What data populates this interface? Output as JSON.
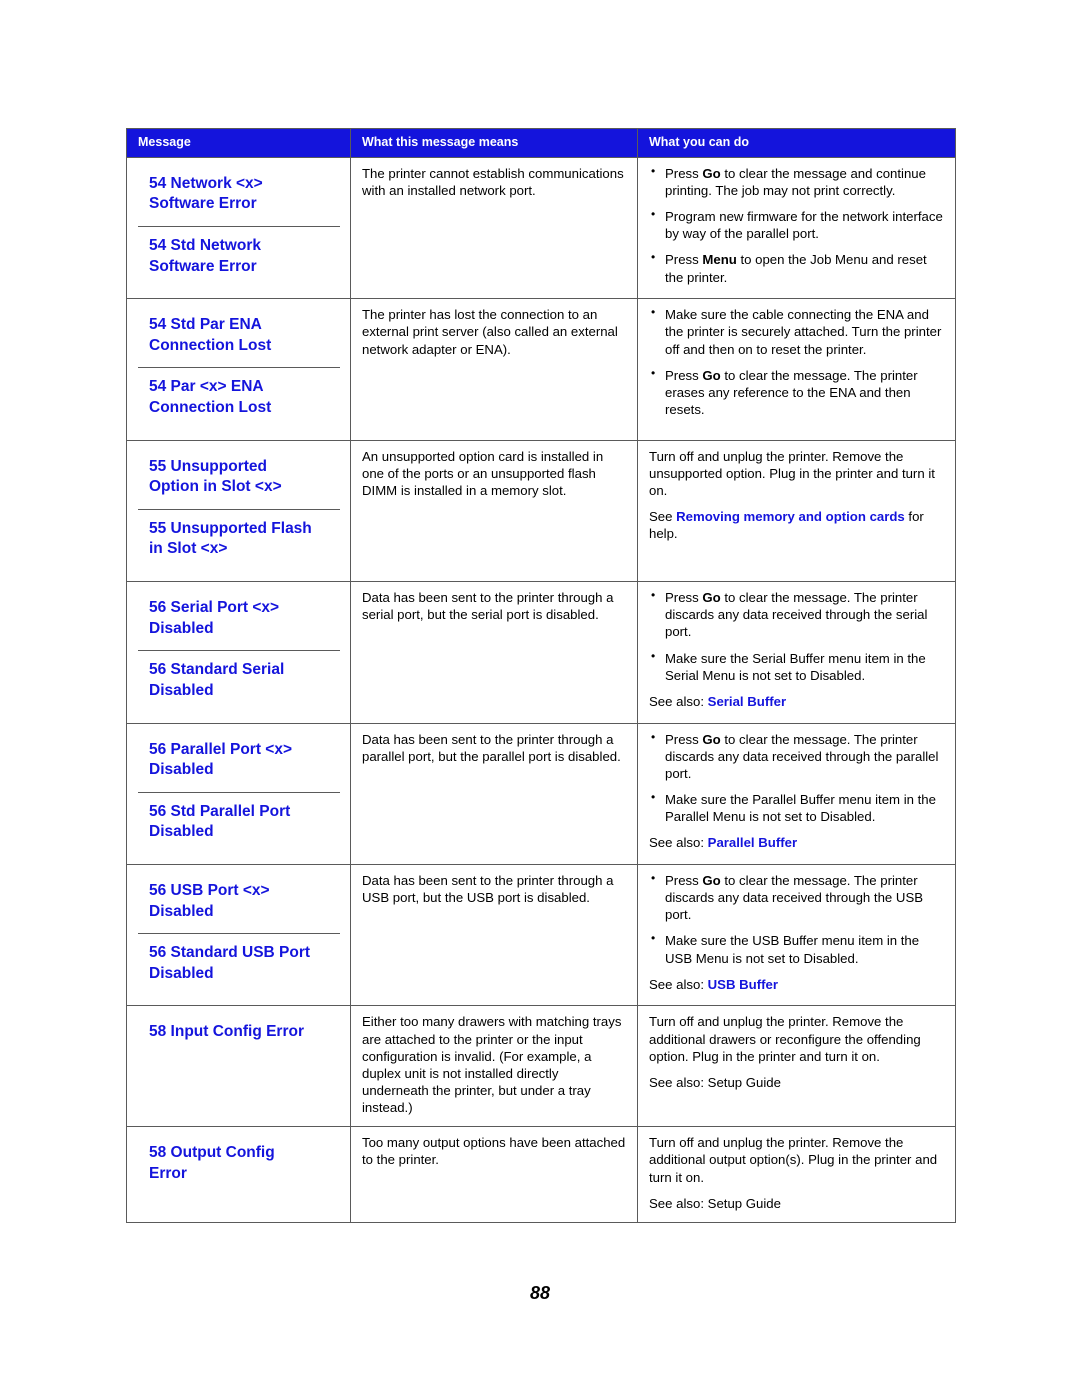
{
  "page": {
    "number": "88"
  },
  "table": {
    "headers": {
      "message": "Message",
      "means": "What this message means",
      "action": "What you can do"
    },
    "rows": [
      {
        "messages": [
          "54 Network <x>\nSoftware Error",
          "54 Std Network\nSoftware Error"
        ],
        "means": "The printer cannot establish communications with an installed network port.",
        "bullets": [
          {
            "pre": "Press ",
            "bold": "Go",
            "post": " to clear the message and continue printing. The job may not print correctly."
          },
          {
            "pre": "Program new firmware for the network interface by way of the parallel port.",
            "bold": "",
            "post": ""
          },
          {
            "pre": "Press ",
            "bold": "Menu",
            "post": " to open the Job Menu and reset the printer."
          }
        ],
        "notes": []
      },
      {
        "messages": [
          "54 Std Par ENA\nConnection Lost",
          "54 Par <x> ENA\nConnection Lost"
        ],
        "means": "The printer has lost the connection to an external print server (also called an external network adapter or ENA).",
        "bullets": [
          {
            "pre": "Make sure the cable connecting the ENA and the printer is securely attached. Turn the printer off and then on to reset the printer.",
            "bold": "",
            "post": ""
          },
          {
            "pre": "Press ",
            "bold": "Go",
            "post": " to clear the message. The printer erases any reference to the ENA and then resets."
          }
        ],
        "notes": []
      },
      {
        "messages": [
          "55 Unsupported\nOption in Slot <x>",
          "55 Unsupported Flash\nin Slot <x>"
        ],
        "means": "An unsupported option card is installed in one of the ports or an unsupported flash DIMM is installed in a memory slot.",
        "bullets": [],
        "paragraphs": [
          "Turn off and unplug the printer. Remove the unsupported option. Plug in the printer and turn it on."
        ],
        "notes": [
          {
            "pre": "See ",
            "link": "Removing memory and option cards",
            "post": " for help."
          }
        ]
      },
      {
        "messages": [
          "56 Serial Port <x>\nDisabled",
          "56 Standard Serial\nDisabled"
        ],
        "means": "Data has been sent to the printer through a serial port, but the serial port is disabled.",
        "bullets": [
          {
            "pre": "Press ",
            "bold": "Go",
            "post": " to clear the message. The printer discards any data received through the serial port."
          },
          {
            "pre": "Make sure the Serial Buffer menu item in the Serial Menu is not set to Disabled.",
            "bold": "",
            "post": ""
          }
        ],
        "notes": [
          {
            "pre": "See also: ",
            "link": "Serial Buffer",
            "post": ""
          }
        ]
      },
      {
        "messages": [
          "56 Parallel Port <x>\nDisabled",
          "56 Std Parallel Port\nDisabled"
        ],
        "means": "Data has been sent to the printer through a parallel port, but the parallel port is disabled.",
        "bullets": [
          {
            "pre": "Press ",
            "bold": "Go",
            "post": " to clear the message. The printer discards any data received through the parallel port."
          },
          {
            "pre": "Make sure the Parallel Buffer menu item in the Parallel Menu is not set to Disabled.",
            "bold": "",
            "post": ""
          }
        ],
        "notes": [
          {
            "pre": "See also: ",
            "link": "Parallel Buffer",
            "post": ""
          }
        ]
      },
      {
        "messages": [
          "56 USB Port <x>\nDisabled",
          "56 Standard USB Port\nDisabled"
        ],
        "means": "Data has been sent to the printer through a USB port, but the USB port is disabled.",
        "bullets": [
          {
            "pre": "Press ",
            "bold": "Go",
            "post": " to clear the message. The printer discards any data received through the USB port."
          },
          {
            "pre": "Make sure the USB Buffer menu item in the USB Menu is not set to Disabled.",
            "bold": "",
            "post": ""
          }
        ],
        "notes": [
          {
            "pre": "See also: ",
            "link": "USB Buffer",
            "post": ""
          }
        ]
      },
      {
        "messages": [
          "58 Input Config Error"
        ],
        "means": "Either too many drawers with matching trays are attached to the printer or the input configuration is invalid. (For example, a duplex unit is not installed directly underneath the printer, but under a tray instead.)",
        "bullets": [],
        "paragraphs": [
          "Turn off and unplug the printer. Remove the additional drawers or reconfigure the offending option. Plug in the printer and turn it on."
        ],
        "notes": [
          {
            "pre": "See also: Setup Guide",
            "link": "",
            "post": ""
          }
        ]
      },
      {
        "messages": [
          "58 Output Config\nError"
        ],
        "means": "Too many output options have been attached to the printer.",
        "bullets": [],
        "paragraphs": [
          "Turn off and unplug the printer. Remove the additional output option(s). Plug in the printer and turn it on."
        ],
        "notes": [
          {
            "pre": "See also: Setup Guide",
            "link": "",
            "post": ""
          }
        ]
      }
    ]
  },
  "colors": {
    "header_bg": "#1414dc",
    "link": "#1414dc",
    "border": "#5a5a5a"
  }
}
